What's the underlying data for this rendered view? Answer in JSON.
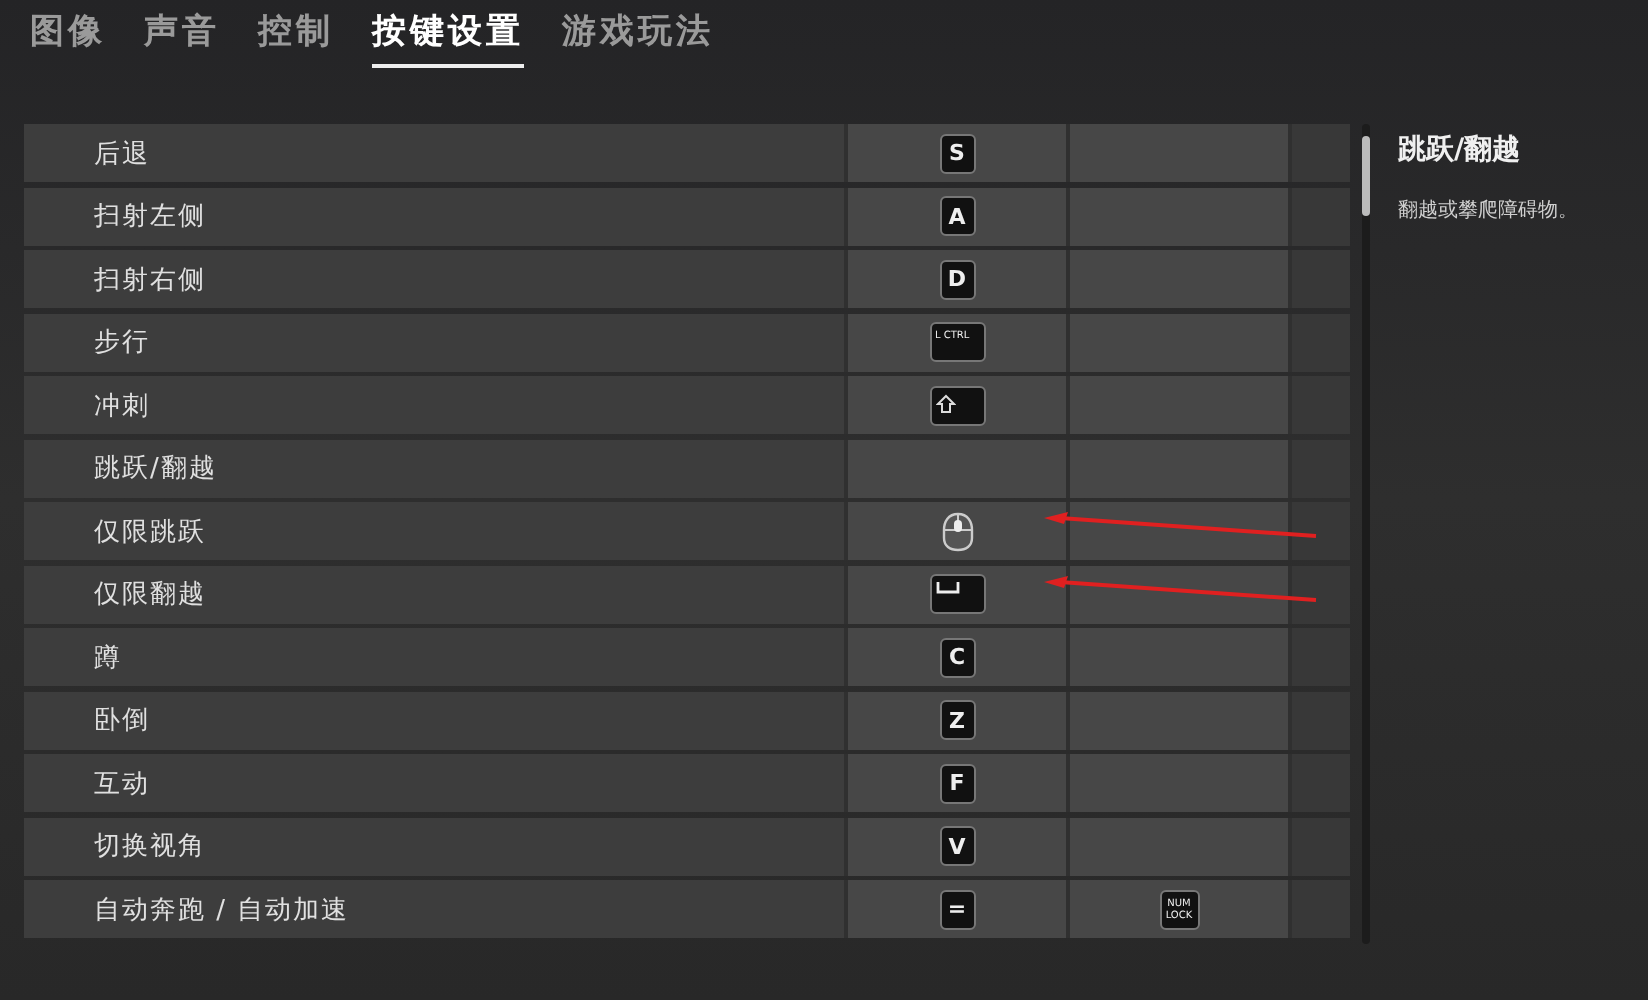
{
  "tabs": [
    {
      "label": "图像",
      "selected": false
    },
    {
      "label": "声音",
      "selected": false
    },
    {
      "label": "控制",
      "selected": false
    },
    {
      "label": "按键设置",
      "selected": true
    },
    {
      "label": "游戏玩法",
      "selected": false
    }
  ],
  "bindings": [
    {
      "action": "后退",
      "annotated": false,
      "primary": {
        "kind": "key",
        "text": "S"
      },
      "secondary": {
        "kind": "none"
      }
    },
    {
      "action": "扫射左侧",
      "annotated": false,
      "primary": {
        "kind": "key",
        "text": "A"
      },
      "secondary": {
        "kind": "none"
      }
    },
    {
      "action": "扫射右侧",
      "annotated": false,
      "primary": {
        "kind": "key",
        "text": "D"
      },
      "secondary": {
        "kind": "none"
      }
    },
    {
      "action": "步行",
      "annotated": false,
      "primary": {
        "kind": "wide",
        "text": "L CTRL"
      },
      "secondary": {
        "kind": "none"
      }
    },
    {
      "action": "冲刺",
      "annotated": false,
      "primary": {
        "kind": "shift"
      },
      "secondary": {
        "kind": "none"
      }
    },
    {
      "action": "跳跃/翻越",
      "annotated": false,
      "primary": {
        "kind": "none"
      },
      "secondary": {
        "kind": "none"
      }
    },
    {
      "action": "仅限跳跃",
      "annotated": true,
      "primary": {
        "kind": "mouse"
      },
      "secondary": {
        "kind": "none"
      }
    },
    {
      "action": "仅限翻越",
      "annotated": true,
      "primary": {
        "kind": "space"
      },
      "secondary": {
        "kind": "none"
      }
    },
    {
      "action": "蹲",
      "annotated": false,
      "primary": {
        "kind": "key",
        "text": "C"
      },
      "secondary": {
        "kind": "none"
      }
    },
    {
      "action": "卧倒",
      "annotated": false,
      "primary": {
        "kind": "key",
        "text": "Z"
      },
      "secondary": {
        "kind": "none"
      }
    },
    {
      "action": "互动",
      "annotated": false,
      "primary": {
        "kind": "key",
        "text": "F"
      },
      "secondary": {
        "kind": "none"
      }
    },
    {
      "action": "切换视角",
      "annotated": false,
      "primary": {
        "kind": "key",
        "text": "V"
      },
      "secondary": {
        "kind": "none"
      }
    },
    {
      "action": "自动奔跑 / 自动加速",
      "annotated": false,
      "primary": {
        "kind": "key",
        "text": "="
      },
      "secondary": {
        "kind": "small",
        "text": "NUM LOCK"
      }
    }
  ],
  "detail": {
    "title": "跳跃/翻越",
    "description": "翻越或攀爬障碍物。"
  }
}
